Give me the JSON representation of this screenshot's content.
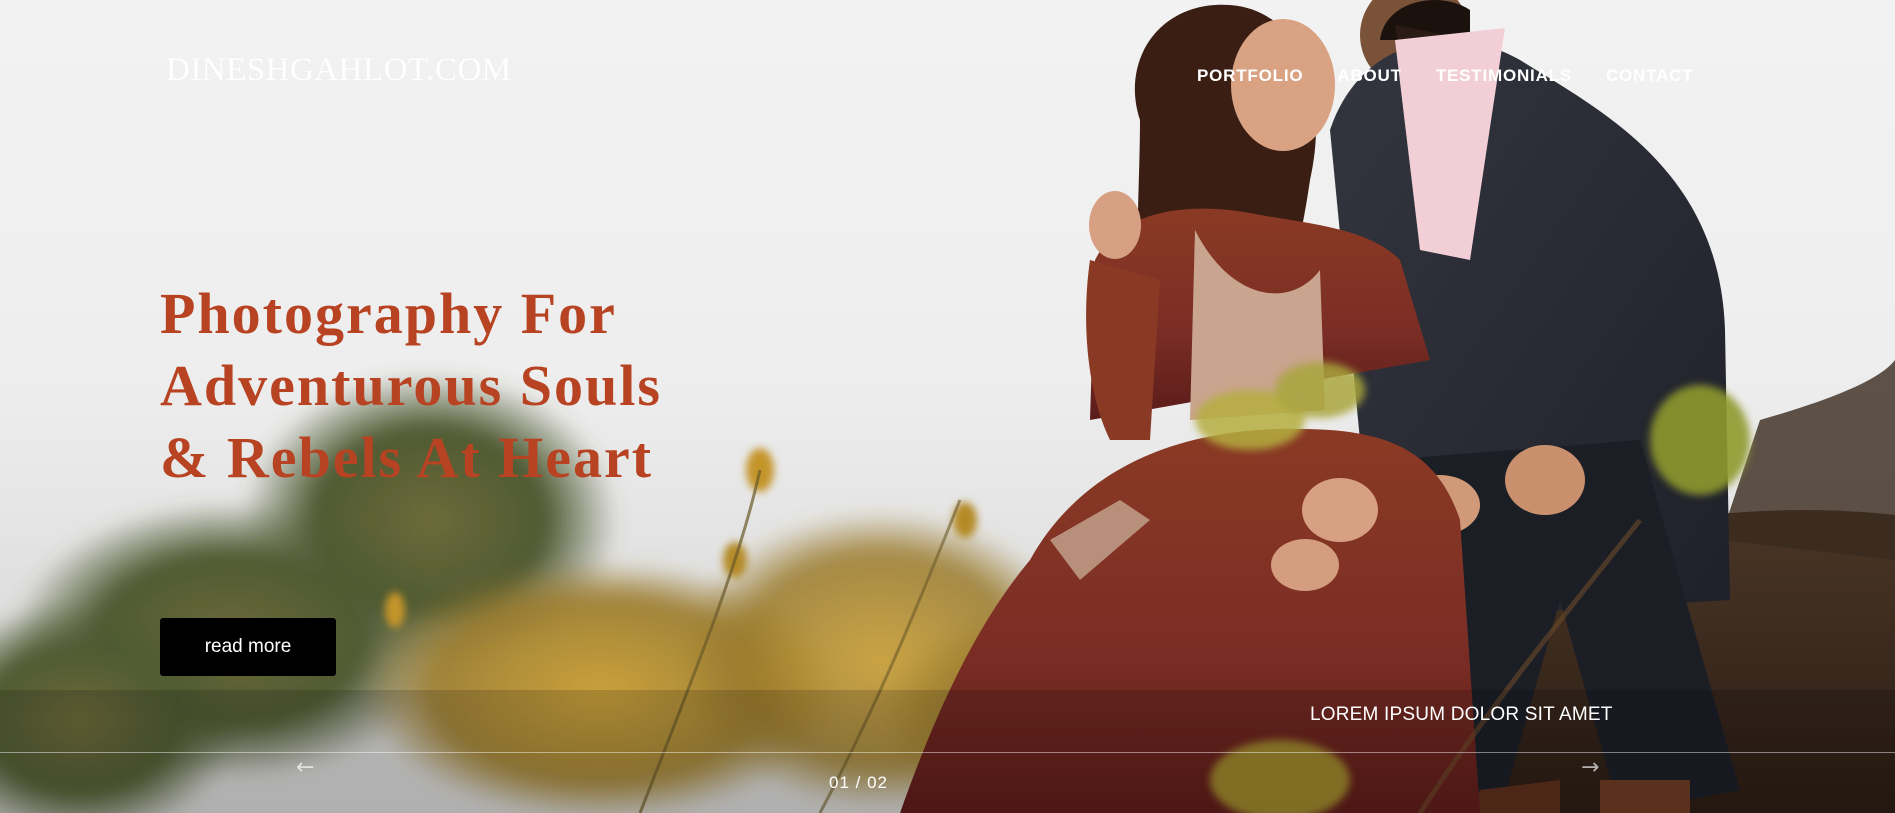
{
  "brand": {
    "name": "DINESHGAHLOT.COM"
  },
  "nav": {
    "items": [
      {
        "label": "PORTFOLIO"
      },
      {
        "label": "ABOUT"
      },
      {
        "label": "TESTIMONIALS"
      },
      {
        "label": "CONTACT"
      }
    ]
  },
  "hero": {
    "headline": [
      "Photography For",
      "Adventurous Souls",
      "& Rebels At Heart"
    ],
    "cta_label": "read more",
    "caption": "LOREM IPSUM DOLOR SIT AMET",
    "slider": {
      "prev_icon": "arrow-left-icon",
      "next_icon": "arrow-right-icon",
      "prev_glyph": "←",
      "next_glyph": "→",
      "counter": "01 / 02"
    }
  },
  "colors": {
    "headline": "#b84322",
    "button_bg": "#000000",
    "nav_text": "#ffffff"
  }
}
